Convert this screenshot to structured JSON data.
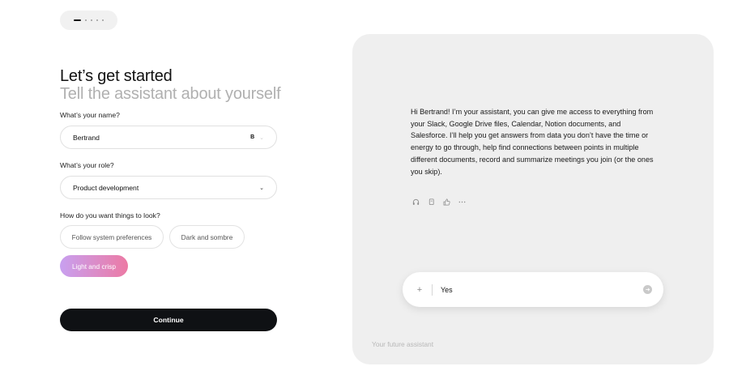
{
  "progress": {
    "current_step": 1,
    "total_steps": 5
  },
  "heading": {
    "line1": "Let’s get started",
    "line2": "Tell the assistant about yourself"
  },
  "form": {
    "name": {
      "label": "What’s your name?",
      "value": "Bertrand",
      "badge": "B"
    },
    "role": {
      "label": "What’s your role?",
      "value": "Product development"
    },
    "look": {
      "label": "How do you want things to look?",
      "options": [
        "Follow system preferences",
        "Dark and sombre",
        "Light and crisp"
      ],
      "selected": "Light and crisp"
    },
    "continue_label": "Continue"
  },
  "assistant": {
    "message": "Hi Bertrand! I’m your assistant, you can give me access to everything from your Slack, Google Drive files, Calendar, Notion documents, and Salesforce. I’ll help you get answers from data you don’t have the time or energy to go through, help find connections between points in multiple different documents, record and summarize meetings you join (or the ones you skip).",
    "actions": [
      "headphones-icon",
      "copy-icon",
      "thumbs-up-icon",
      "more-icon"
    ],
    "input_value": "Yes",
    "footer": "Your future assistant"
  },
  "colors": {
    "accent_gradient_start": "#c8a0f0",
    "accent_gradient_end": "#ec7aa4",
    "primary_button": "#0f1114",
    "panel_bg": "#efefef"
  }
}
